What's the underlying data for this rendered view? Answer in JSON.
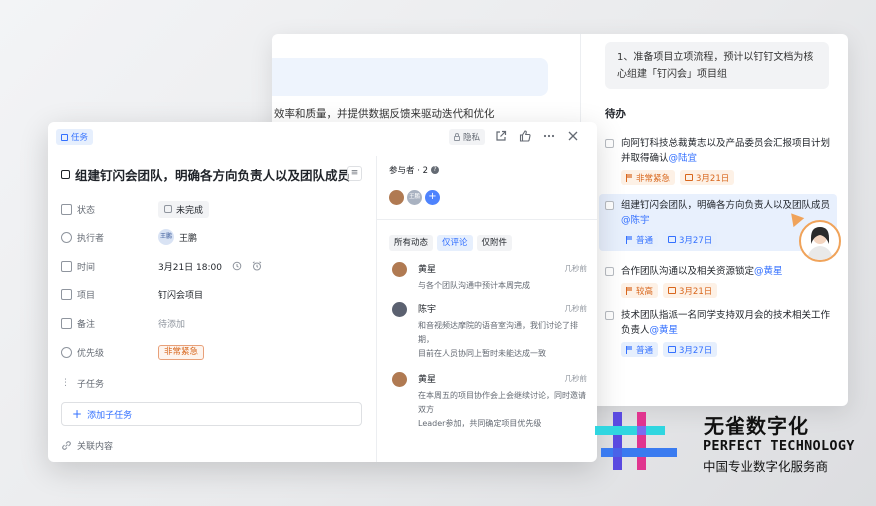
{
  "doc": {
    "left_text": "效率和质量，并提供数据反馈来驱动迭代和优化",
    "quote_line1": "1、准备项目立项流程，预计以钉钉文档为核",
    "quote_line2": "心组建「钉闪会」项目组",
    "todo_title": "待办",
    "todos": [
      {
        "text": "向阿钉科技总裁黄志以及产品委员会汇报项目计划并取得确认",
        "mention": "@陆宜",
        "tag1": "非常紧急",
        "tag1_color": "#d8661c",
        "tag2": "3月21日",
        "tag2_color": "#d8661c"
      },
      {
        "text": "组建钉闪会团队，明确各方向负责人以及团队成员",
        "mention": "@陈宇",
        "tag1": "普通",
        "tag1_color": "#3370ff",
        "tag2": "3月27日",
        "tag2_color": "#3370ff"
      },
      {
        "text": "合作团队沟通以及相关资源锁定",
        "mention": "@黄星",
        "tag1": "较高",
        "tag1_color": "#d8661c",
        "tag2": "3月21日",
        "tag2_color": "#d8661c"
      },
      {
        "text": "技术团队指派一名同学支持双月会的技术相关工作负责人",
        "mention": "@黄星",
        "tag1": "普通",
        "tag1_color": "#3370ff",
        "tag2": "3月27日",
        "tag2_color": "#3370ff"
      }
    ]
  },
  "task": {
    "badge": "任务",
    "private_label": "隐私",
    "title": "组建钉闪会团队，明确各方向负责人以及团队成员",
    "fields": {
      "status_label": "状态",
      "status_value": "未完成",
      "assignee_label": "执行者",
      "assignee_avatar": "王鹏",
      "assignee_value": "王鹏",
      "time_label": "时间",
      "time_value": "3月21日 18:00",
      "project_label": "项目",
      "project_value": "钉闪会项目",
      "note_label": "备注",
      "note_value": "待添加",
      "priority_label": "优先级",
      "priority_value": "非常紧急",
      "subtask_label": "子任务",
      "add_subtask": "添加子任务",
      "related_label": "关联内容"
    },
    "participants_label": "参与者 · 2",
    "participant_avatar2": "王鹏",
    "filters": [
      "所有动态",
      "仅评论",
      "仅附件"
    ],
    "comments": [
      {
        "name": "黄星",
        "time": "几秒前",
        "body": "与各个团队沟通中预计本周完成"
      },
      {
        "name": "陈宇",
        "time": "几秒前",
        "body": "和音视频达摩院的语音室沟通，我们讨论了排期，\n目前在人员协同上暂时未能达成一致"
      },
      {
        "name": "黄星",
        "time": "几秒前",
        "body": "在本周五的项目协作会上会继续讨论，同时邀请双方\nLeader参加，共同确定项目优先级"
      }
    ]
  },
  "brand": {
    "name_cn": "无雀数字化",
    "name_en": "PERFECT TECHNOLOGY",
    "slogan": "中国专业数字化服务商"
  }
}
